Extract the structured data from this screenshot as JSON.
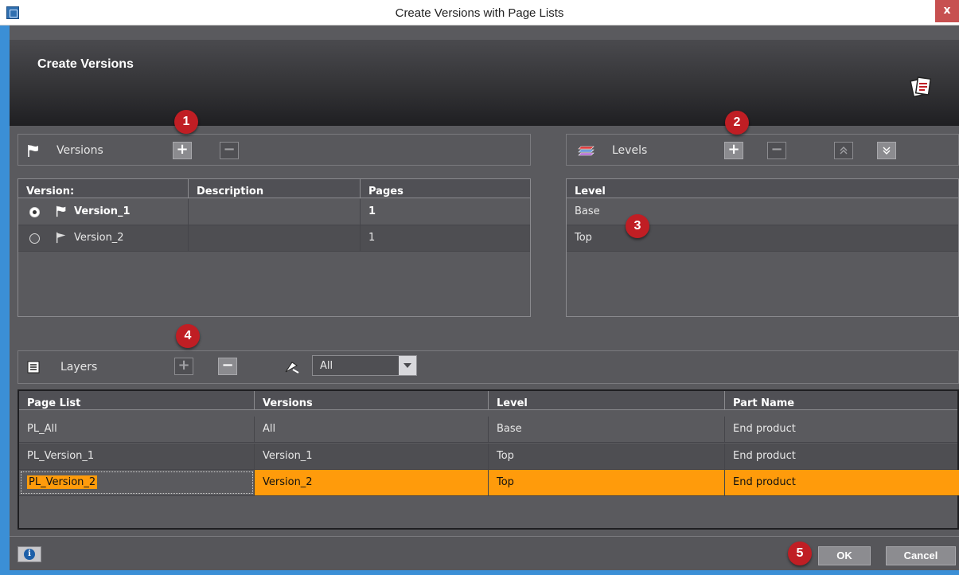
{
  "window": {
    "title": "Create Versions with Page Lists",
    "close_label": "x"
  },
  "header": {
    "heading": "Create Versions"
  },
  "versions": {
    "label": "Versions",
    "columns": [
      "Version:",
      "Description",
      "Pages"
    ],
    "rows": [
      {
        "name": "Version_1",
        "description": "",
        "pages": "1",
        "selected": true
      },
      {
        "name": "Version_2",
        "description": "",
        "pages": "1",
        "selected": false
      }
    ]
  },
  "levels": {
    "label": "Levels",
    "columns": [
      "Level"
    ],
    "rows": [
      {
        "name": "Base"
      },
      {
        "name": "Top"
      }
    ]
  },
  "layers": {
    "label": "Layers",
    "filter_value": "All",
    "columns": [
      "Page List",
      "Versions",
      "Level",
      "Part Name"
    ],
    "rows": [
      {
        "page_list": "PL_All",
        "versions": "All",
        "level": "Base",
        "part_name": "End product"
      },
      {
        "page_list": "PL_Version_1",
        "versions": "Version_1",
        "level": "Top",
        "part_name": "End product"
      },
      {
        "page_list": "PL_Version_2",
        "versions": "Version_2",
        "level": "Top",
        "part_name": "End product"
      }
    ]
  },
  "buttons": {
    "add": "+",
    "remove": "−",
    "ok": "OK",
    "cancel": "Cancel",
    "info": "i"
  },
  "callouts": [
    "1",
    "2",
    "3",
    "4",
    "5"
  ],
  "colors": {
    "selection": "#ff9b0b",
    "callout": "#c01e24",
    "accent_strip": "#3b8fd6"
  }
}
